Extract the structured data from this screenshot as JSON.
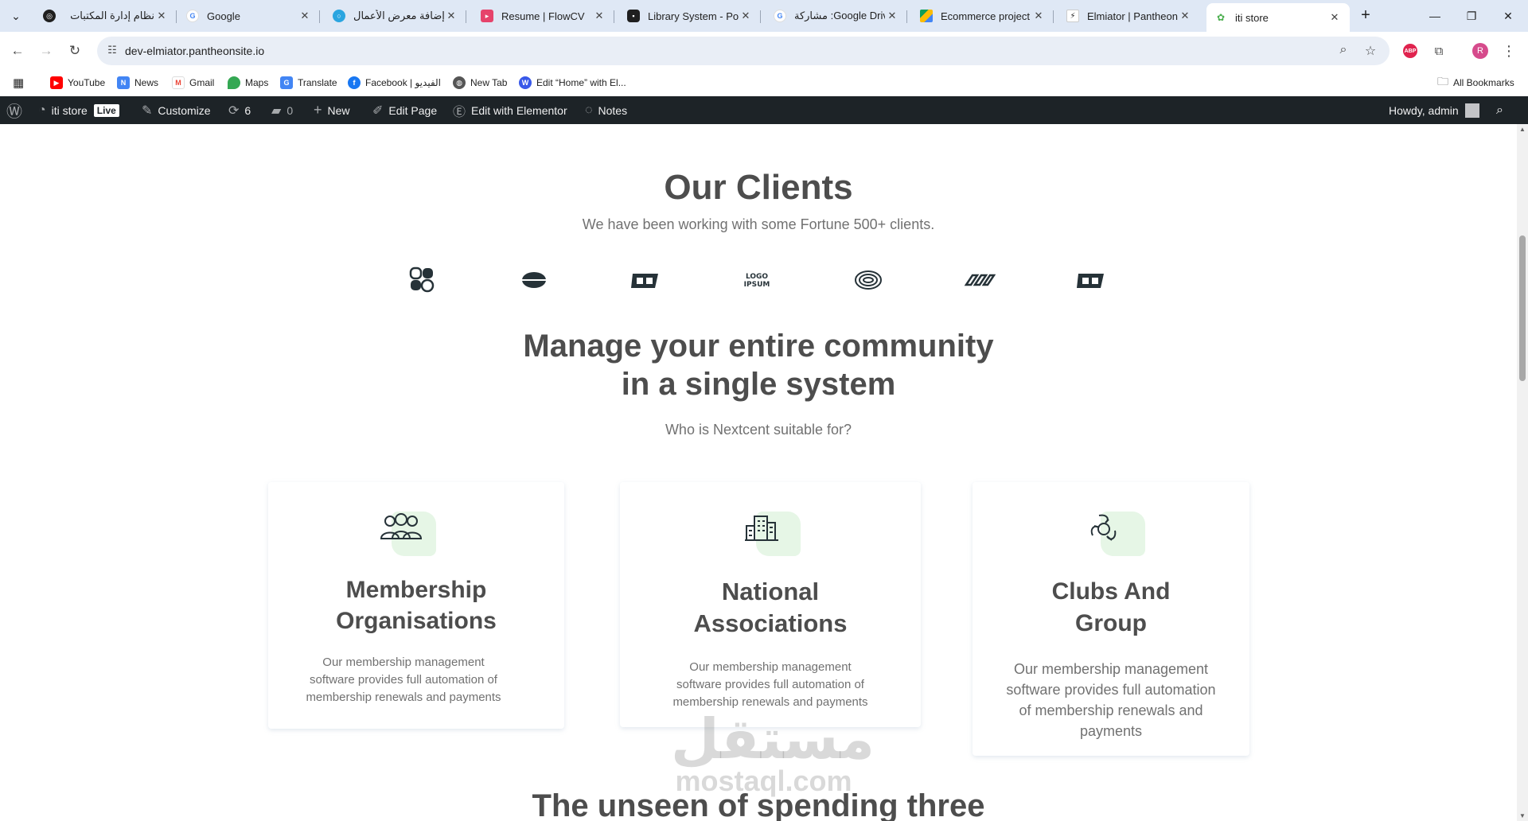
{
  "browser": {
    "tabs": [
      {
        "title": "نظام إدارة المكتبات",
        "favicon": "github-icon"
      },
      {
        "title": "Google",
        "favicon": "google-icon"
      },
      {
        "title": "إضافة معرض الأعمال",
        "favicon": "mostaql-icon"
      },
      {
        "title": "Resume | FlowCV",
        "favicon": "flowcv-icon"
      },
      {
        "title": "Library System - Poe",
        "favicon": "poe-icon"
      },
      {
        "title": "مشاركة :Google Drive",
        "favicon": "google-icon"
      },
      {
        "title": "Ecommerce project -",
        "favicon": "drive-icon"
      },
      {
        "title": "Elmiator | Pantheon D",
        "favicon": "pantheon-icon"
      },
      {
        "title": "iti store",
        "favicon": "site-icon"
      }
    ],
    "active_tab": 8,
    "url": "dev-elmiator.pantheonsite.io",
    "profile_initial": "R",
    "bookmarks": [
      {
        "label": "YouTube"
      },
      {
        "label": "News"
      },
      {
        "label": "Gmail"
      },
      {
        "label": "Maps"
      },
      {
        "label": "Translate"
      },
      {
        "label": "Facebook | الفيديو"
      },
      {
        "label": "New Tab"
      },
      {
        "label": "Edit “Home” with El..."
      }
    ],
    "all_bookmarks": "All Bookmarks",
    "abp_label": "ABP"
  },
  "wp_admin_bar": {
    "site_name": "iti store",
    "live_badge": "Live",
    "customize": "Customize",
    "updates_count": "6",
    "comments_count": "0",
    "new": "New",
    "edit_page": "Edit Page",
    "edit_elementor": "Edit with Elementor",
    "notes": "Notes",
    "howdy": "Howdy, admin"
  },
  "clients": {
    "title": "Our Clients",
    "subtitle": "We have been working with some Fortune 500+ clients."
  },
  "manage": {
    "title_line1": "Manage your entire community",
    "title_line2": "in a single system",
    "subtitle": "Who is Nextcent suitable for?"
  },
  "cards": [
    {
      "title_line1": "Membership",
      "title_line2": "Organisations",
      "text": [
        "Our membership management",
        "software provides full automation of",
        "membership renewals and payments"
      ],
      "icon": "people-group-icon"
    },
    {
      "title_line1": "National",
      "title_line2": "Associations",
      "text": [
        "Our membership management",
        "software provides full automation of",
        "membership renewals and payments"
      ],
      "icon": "building-icon"
    },
    {
      "title_line1": "Clubs And",
      "title_line2": "Group",
      "text": [
        "Our membership management",
        "software provides full automation",
        "of membership renewals and",
        "payments"
      ],
      "icon": "hands-circle-icon"
    }
  ],
  "next_section": {
    "title": "The unseen of spending three"
  },
  "watermark": {
    "arabic": "مستقل",
    "latin": "mostaql.com"
  },
  "colors": {
    "accent_green": "#4caf4f",
    "icon_bg": "#e6f6e6",
    "heading": "#4d4d4d",
    "wp_bar": "#1d2327"
  }
}
